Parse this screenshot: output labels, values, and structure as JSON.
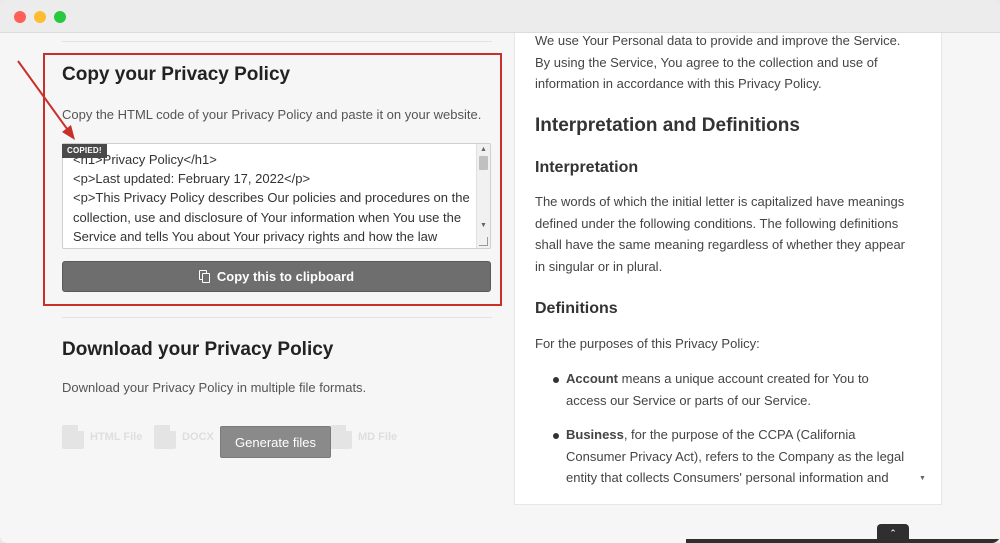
{
  "colors": {
    "highlight": "#c8302c",
    "button": "#6e6e6e",
    "generate_button": "#8a8a8a"
  },
  "left": {
    "copy_section": {
      "title": "Copy your Privacy Policy",
      "description": "Copy the HTML code of your Privacy Policy and paste it on your website.",
      "copied_badge": "COPIED!",
      "code_lines": [
        "<h1>Privacy Policy</h1>",
        "<p>Last updated: February 17, 2022</p>",
        "<p>This Privacy Policy describes Our policies and procedures on the",
        "collection, use and disclosure of Your information when You use the",
        "Service and tells You about Your privacy rights and how the law"
      ],
      "copy_button": "Copy this to clipboard",
      "copy_icon": "clipboard-icon"
    },
    "download_section": {
      "title": "Download your Privacy Policy",
      "description": "Download your Privacy Policy in multiple file formats.",
      "formats": [
        "HTML File",
        "DOCX",
        "MD File"
      ],
      "generate_button": "Generate files"
    }
  },
  "right": {
    "intro": "We use Your Personal data to provide and improve the Service. By using the Service, You agree to the collection and use of information in accordance with this Privacy Policy.",
    "h2": "Interpretation and Definitions",
    "h3_interpretation": "Interpretation",
    "interpretation_text": "The words of which the initial letter is capitalized have meanings defined under the following conditions. The following definitions shall have the same meaning regardless of whether they appear in singular or in plural.",
    "h3_definitions": "Definitions",
    "definitions_intro": "For the purposes of this Privacy Policy:",
    "items": [
      {
        "term": "Account",
        "text": " means a unique account created for You to access our Service or parts of our Service."
      },
      {
        "term": "Business",
        "text": ", for the purpose of the CCPA (California Consumer Privacy Act), refers to the Company as the legal entity that collects Consumers' personal information and"
      }
    ]
  },
  "bottom_tab_icon": "chevron-up-icon"
}
